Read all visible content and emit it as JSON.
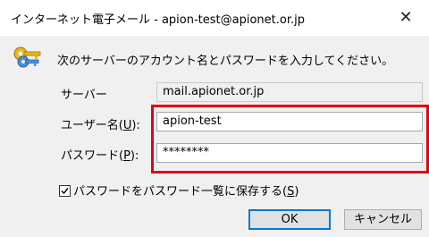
{
  "window": {
    "title": "インターネット電子メール - apion-test@apionet.or.jp",
    "close_symbol": "✕"
  },
  "prompt": "次のサーバーのアカウント名とパスワードを入力してください。",
  "server": {
    "label": "サーバー",
    "value": "mail.apionet.or.jp"
  },
  "username": {
    "label": "ユーザー名(",
    "accelerator": "U",
    "label_end": "):",
    "value": "apion-test"
  },
  "password": {
    "label": "パスワード(",
    "accelerator": "P",
    "label_end": "):",
    "value": "********"
  },
  "save_password": {
    "label": "パスワードをパスワード一覧に保存する(",
    "accelerator": "S",
    "label_end": ")",
    "checked": true
  },
  "buttons": {
    "ok": "OK",
    "cancel": "キャンセル"
  },
  "colors": {
    "highlight": "#e60012",
    "default_button_border": "#0078d7"
  },
  "icons": {
    "prompt_icon": "keys-icon",
    "close": "close-icon"
  }
}
